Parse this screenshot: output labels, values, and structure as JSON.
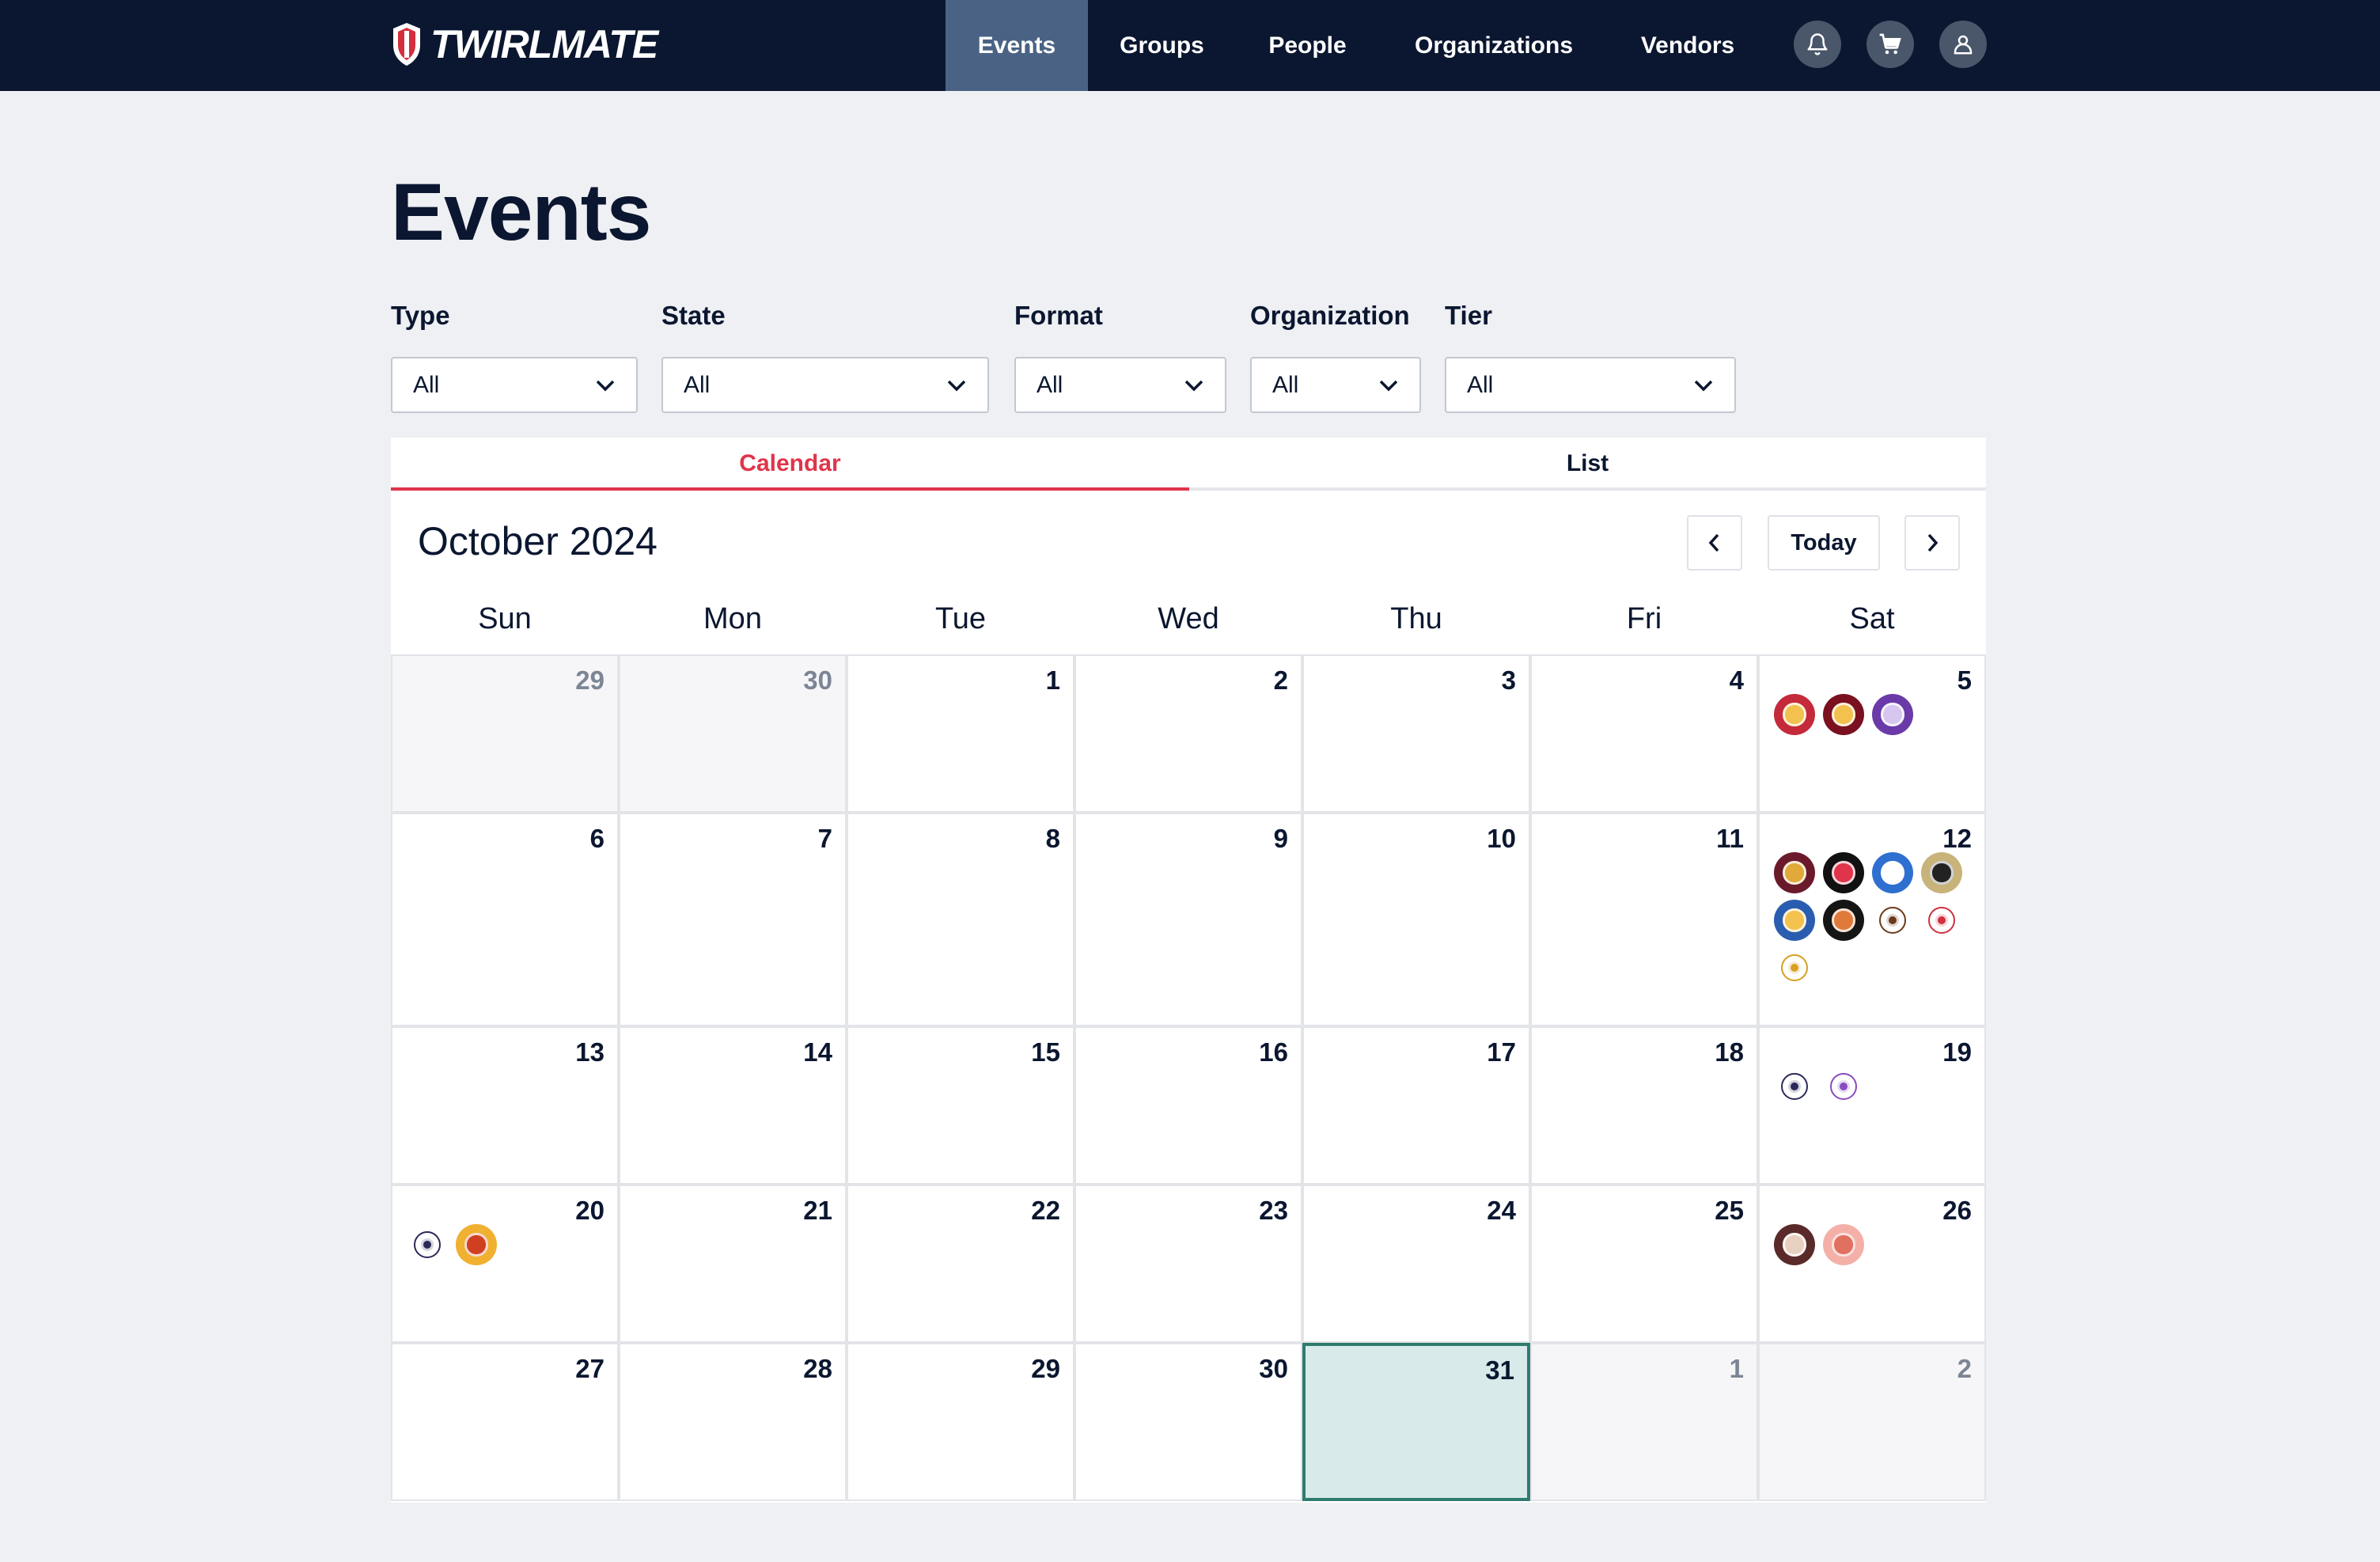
{
  "brand": {
    "name": "TWIRLMATE"
  },
  "nav": {
    "items": [
      "Events",
      "Groups",
      "People",
      "Organizations",
      "Vendors"
    ],
    "active": "Events"
  },
  "header_icons": [
    "bell-icon",
    "cart-icon",
    "user-icon"
  ],
  "page": {
    "title": "Events"
  },
  "filters": [
    {
      "label": "Type",
      "value": "All"
    },
    {
      "label": "State",
      "value": "All"
    },
    {
      "label": "Format",
      "value": "All"
    },
    {
      "label": "Organization",
      "value": "All"
    },
    {
      "label": "Tier",
      "value": "All"
    }
  ],
  "tabs": [
    {
      "label": "Calendar",
      "active": true
    },
    {
      "label": "List",
      "active": false
    }
  ],
  "calendar": {
    "month_label": "October 2024",
    "today_label": "Today",
    "weekdays": [
      "Sun",
      "Mon",
      "Tue",
      "Wed",
      "Thu",
      "Fri",
      "Sat"
    ],
    "weeks": [
      [
        {
          "day": "29",
          "other": true,
          "events": []
        },
        {
          "day": "30",
          "other": true,
          "events": []
        },
        {
          "day": "1",
          "events": []
        },
        {
          "day": "2",
          "events": []
        },
        {
          "day": "3",
          "events": []
        },
        {
          "day": "4",
          "events": []
        },
        {
          "day": "5",
          "events": [
            {
              "color": "#c42a3a",
              "accent": "#f2c14e"
            },
            {
              "color": "#7a1020",
              "accent": "#f2c14e"
            },
            {
              "color": "#6a3aa8",
              "accent": "#d6c6f0"
            }
          ]
        }
      ],
      [
        {
          "day": "6",
          "events": []
        },
        {
          "day": "7",
          "events": []
        },
        {
          "day": "8",
          "events": []
        },
        {
          "day": "9",
          "events": []
        },
        {
          "day": "10",
          "events": []
        },
        {
          "day": "11",
          "events": []
        },
        {
          "day": "12",
          "events": [
            {
              "color": "#6b1a2c",
              "accent": "#e0a93a"
            },
            {
              "color": "#111111",
              "accent": "#e0344a"
            },
            {
              "color": "#2e6fd0",
              "accent": "#ffffff"
            },
            {
              "color": "#c8b37a",
              "accent": "#222222"
            },
            {
              "color": "#2a5db0",
              "accent": "#f2c14e"
            },
            {
              "color": "#151515",
              "accent": "#e07a3a"
            },
            {
              "color": "#ffffff",
              "accent": "#6b3a1a",
              "small": true
            },
            {
              "color": "#ffffff",
              "accent": "#d03040",
              "small": true
            },
            {
              "color": "#ffffff",
              "accent": "#d6a020",
              "small": true
            }
          ]
        }
      ],
      [
        {
          "day": "13",
          "events": []
        },
        {
          "day": "14",
          "events": []
        },
        {
          "day": "15",
          "events": []
        },
        {
          "day": "16",
          "events": []
        },
        {
          "day": "17",
          "events": []
        },
        {
          "day": "18",
          "events": []
        },
        {
          "day": "19",
          "events": [
            {
              "color": "#ffffff",
              "accent": "#2a2a5a",
              "small": true
            },
            {
              "color": "#ffffff",
              "accent": "#8a4ac0",
              "small": true
            }
          ]
        }
      ],
      [
        {
          "day": "20",
          "events": [
            {
              "color": "#ffffff",
              "accent": "#2a2a5a",
              "small": true
            },
            {
              "color": "#f0b030",
              "accent": "#d04020"
            }
          ]
        },
        {
          "day": "21",
          "events": []
        },
        {
          "day": "22",
          "events": []
        },
        {
          "day": "23",
          "events": []
        },
        {
          "day": "24",
          "events": []
        },
        {
          "day": "25",
          "events": []
        },
        {
          "day": "26",
          "events": [
            {
              "color": "#5a2a2a",
              "accent": "#e8d0c0"
            },
            {
              "color": "#f4b0a8",
              "accent": "#e07060"
            }
          ]
        }
      ],
      [
        {
          "day": "27",
          "events": []
        },
        {
          "day": "28",
          "events": []
        },
        {
          "day": "29",
          "events": []
        },
        {
          "day": "30",
          "events": []
        },
        {
          "day": "31",
          "today": true,
          "events": []
        },
        {
          "day": "1",
          "other": true,
          "events": []
        },
        {
          "day": "2",
          "other": true,
          "events": []
        }
      ]
    ]
  },
  "colors": {
    "topbar": "#0b1730",
    "nav_active": "#4a6385",
    "accent_red": "#e0344a",
    "today_bg": "#d8ebea",
    "today_border": "#2f7c6f"
  }
}
